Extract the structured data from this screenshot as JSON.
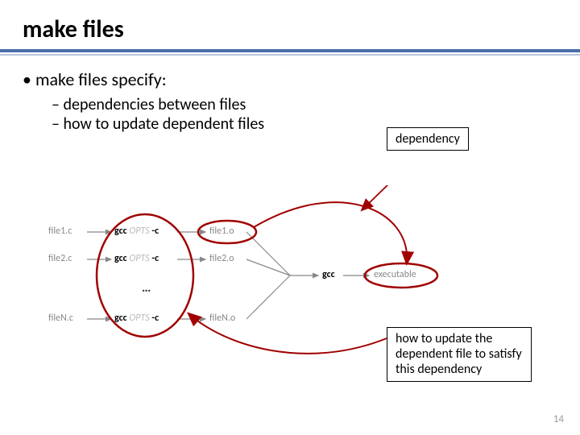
{
  "title": "make files",
  "bullets": {
    "main": "make files specify:",
    "sub1": "dependencies between files",
    "sub2": "how to update dependent files"
  },
  "labels": {
    "dependency": "dependency",
    "howto": "how to update the dependent  file to satisfy this dependency"
  },
  "diagram": {
    "row1": {
      "src": "file1.c",
      "cmd": "gcc",
      "opts": "OPTS",
      "flag": "-c",
      "obj": "file1.o"
    },
    "row2": {
      "src": "file2.c",
      "cmd": "gcc",
      "opts": "OPTS",
      "flag": "-c",
      "obj": "file2.o"
    },
    "rowN": {
      "src": "fileN.c",
      "cmd": "gcc",
      "opts": "OPTS",
      "flag": "-c",
      "obj": "fileN.o"
    },
    "dots": "…",
    "linkcmd": "gcc",
    "exe": "executable"
  },
  "page": "14"
}
